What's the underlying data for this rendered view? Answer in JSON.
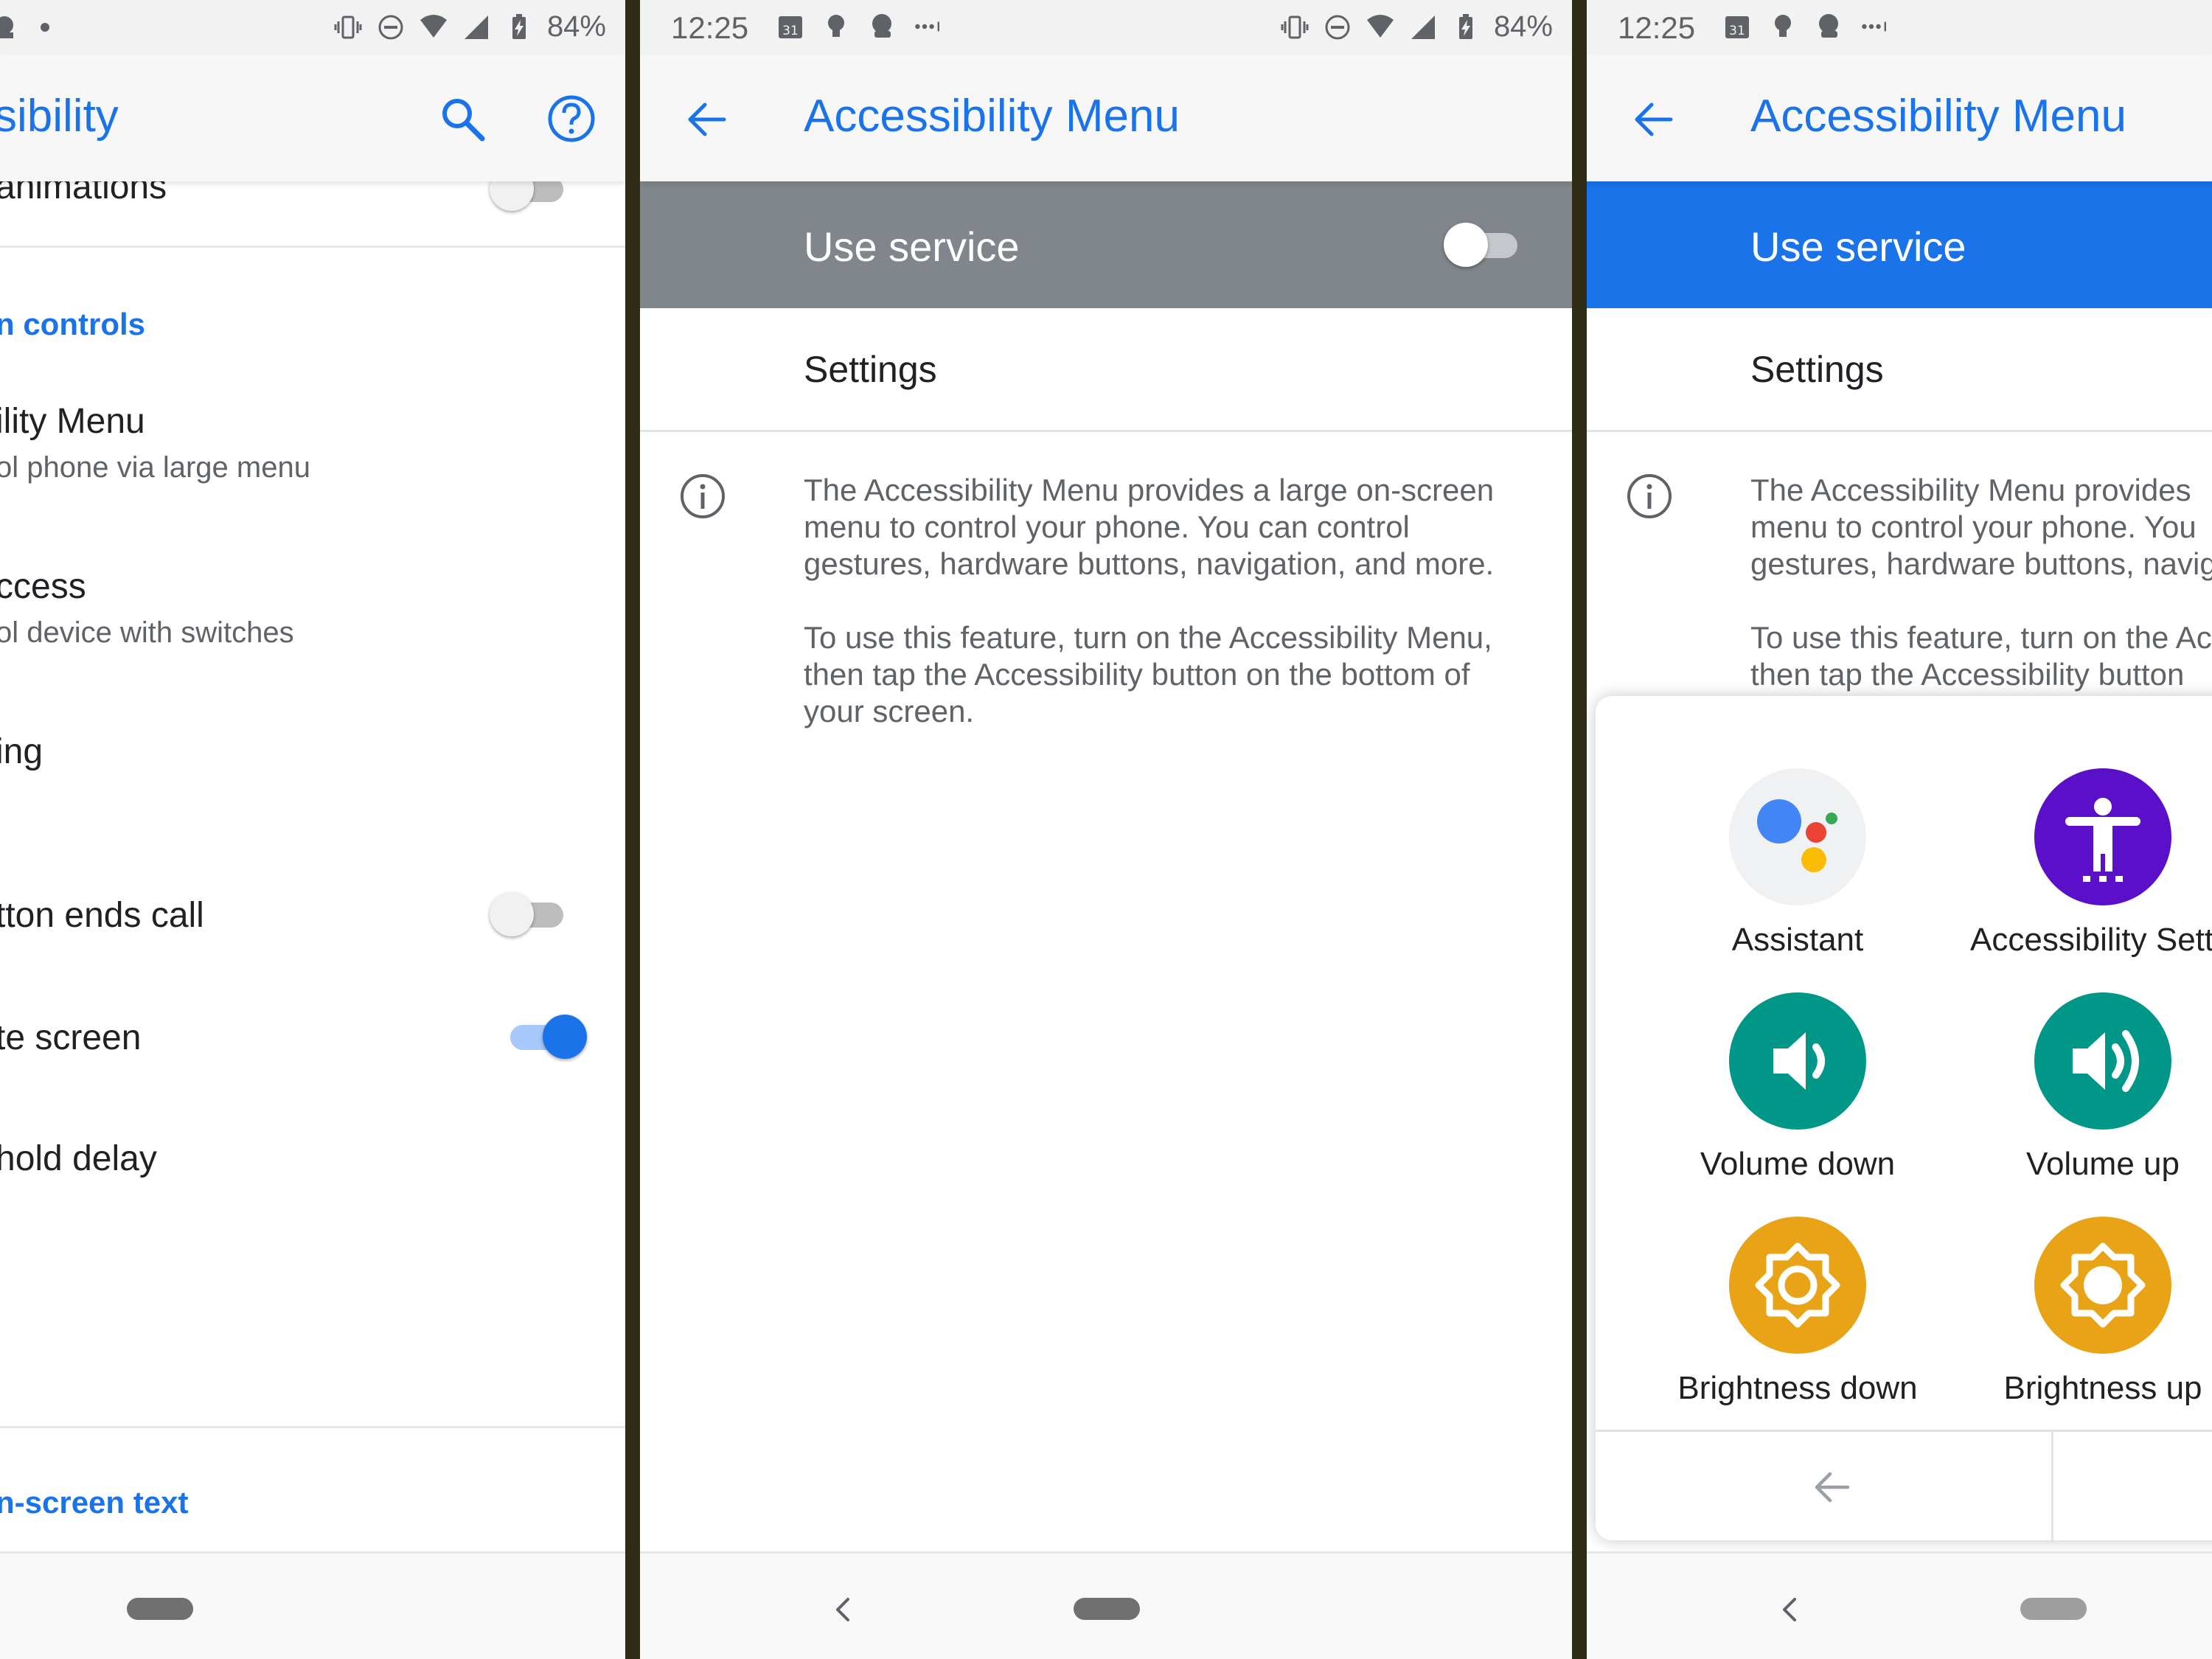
{
  "panel1": {
    "status": {
      "battery": "84%"
    },
    "appbar": {
      "title": "sibility"
    },
    "items": {
      "animations": "animations",
      "section_interaction": "n controls",
      "menu_title": "ility Menu",
      "menu_sub": "ol phone via large menu",
      "switch_title": "ccess",
      "switch_sub": "ol device with switches",
      "timing": "ing",
      "power_ends_call": "tton ends call",
      "auto_rotate": "te screen",
      "hold_delay": "hold delay",
      "section_text": "n-screen text"
    }
  },
  "panel2": {
    "status": {
      "time": "12:25",
      "battery": "84%",
      "calendar": "31"
    },
    "appbar": {
      "title": "Accessibility Menu"
    },
    "use_service": "Use service",
    "settings": "Settings",
    "description": {
      "p1_l1": "The Accessibility Menu provides a large on-screen",
      "p1_l2": "menu to control your phone. You can control",
      "p1_l3": "gestures, hardware buttons, navigation, and more.",
      "p2_l1": "To use this feature, turn on the Accessibility Menu,",
      "p2_l2": "then tap the Accessibility button on the bottom of",
      "p2_l3": "your screen."
    }
  },
  "panel3": {
    "status": {
      "time": "12:25",
      "calendar": "31"
    },
    "appbar": {
      "title": "Accessibility Menu"
    },
    "use_service": "Use service",
    "settings": "Settings",
    "description": {
      "p1_l1": "The Accessibility Menu provides",
      "p1_l2": "menu to control your phone. You",
      "p1_l3": "gestures, hardware buttons, navig",
      "p2_l1": "To use this feature, turn on the Ac",
      "p2_l2": "then tap the Accessibility button"
    },
    "menu": {
      "assistant": "Assistant",
      "accessibility_settings": "Accessibility Setti...",
      "volume_down": "Volume down",
      "volume_up": "Volume up",
      "brightness_down": "Brightness down",
      "brightness_up": "Brightness up"
    }
  },
  "colors": {
    "accent": "#1a73e8",
    "service_off": "#80868b",
    "service_on": "#1a73e8",
    "volume": "#009688",
    "brightness": "#e8a317",
    "accessibility": "#5a0fc8"
  }
}
